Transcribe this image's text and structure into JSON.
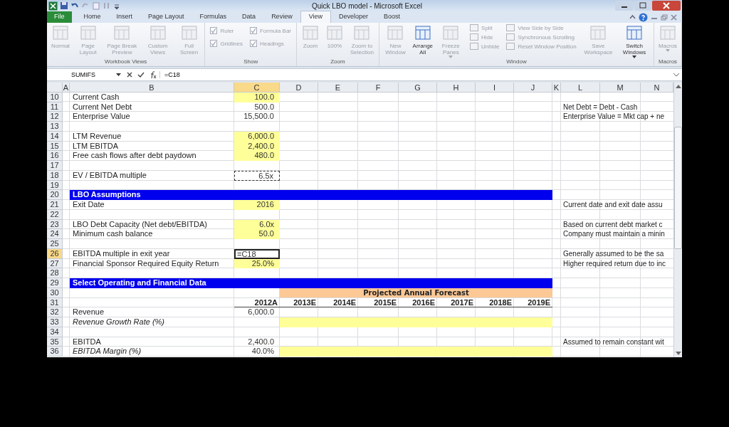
{
  "window": {
    "title": "Quick LBO model - Microsoft Excel"
  },
  "tabs": [
    {
      "label": "File",
      "kind": "file",
      "selected": false
    },
    {
      "label": "Home",
      "kind": "tab",
      "selected": false
    },
    {
      "label": "Insert",
      "kind": "tab",
      "selected": false
    },
    {
      "label": "Page Layout",
      "kind": "tab",
      "selected": false
    },
    {
      "label": "Formulas",
      "kind": "tab",
      "selected": false
    },
    {
      "label": "Data",
      "kind": "tab",
      "selected": false
    },
    {
      "label": "Review",
      "kind": "tab",
      "selected": false
    },
    {
      "label": "View",
      "kind": "tab",
      "selected": true
    },
    {
      "label": "Developer",
      "kind": "tab",
      "selected": false
    },
    {
      "label": "Boost",
      "kind": "tab",
      "selected": false
    }
  ],
  "ribbon": [
    {
      "label": "Workbook Views",
      "items": [
        {
          "kind": "large",
          "label": "Normal",
          "disabled": true
        },
        {
          "kind": "large",
          "label": "Page Layout",
          "disabled": true
        },
        {
          "kind": "large",
          "label": "Page Break Preview",
          "disabled": true
        },
        {
          "kind": "large",
          "label": "Custom Views",
          "disabled": true
        },
        {
          "kind": "large",
          "label": "Full Screen",
          "disabled": true
        }
      ]
    },
    {
      "label": "Show",
      "items": [
        {
          "kind": "column",
          "items": [
            {
              "kind": "check",
              "label": "Ruler",
              "checked": true,
              "disabled": true
            },
            {
              "kind": "check",
              "label": "Gridlines",
              "checked": true,
              "disabled": true
            }
          ]
        },
        {
          "kind": "column",
          "items": [
            {
              "kind": "check",
              "label": "Formula Bar",
              "checked": true,
              "disabled": true
            },
            {
              "kind": "check",
              "label": "Headings",
              "checked": true,
              "disabled": true
            }
          ]
        }
      ]
    },
    {
      "label": "Zoom",
      "items": [
        {
          "kind": "large",
          "label": "Zoom",
          "disabled": true
        },
        {
          "kind": "large",
          "label": "100%",
          "disabled": true
        },
        {
          "kind": "large",
          "label": "Zoom to Selection",
          "disabled": true
        }
      ]
    },
    {
      "label": "Window",
      "items": [
        {
          "kind": "large",
          "label": "New Window",
          "disabled": true
        },
        {
          "kind": "large",
          "label": "Arrange All",
          "disabled": false
        },
        {
          "kind": "large",
          "label": "Freeze Panes",
          "disabled": true,
          "dropdown": true
        },
        {
          "kind": "column",
          "items": [
            {
              "kind": "small",
              "label": "Split",
              "disabled": true
            },
            {
              "kind": "small",
              "label": "Hide",
              "disabled": true
            },
            {
              "kind": "small",
              "label": "Unhide",
              "disabled": true
            }
          ]
        },
        {
          "kind": "column",
          "items": [
            {
              "kind": "small",
              "label": "View Side by Side",
              "disabled": true
            },
            {
              "kind": "small",
              "label": "Synchronous Scrolling",
              "disabled": true
            },
            {
              "kind": "small",
              "label": "Reset Window Position",
              "disabled": true
            }
          ]
        },
        {
          "kind": "large",
          "label": "Save Workspace",
          "disabled": true
        },
        {
          "kind": "large",
          "label": "Switch Windows",
          "disabled": false,
          "dropdown": true
        }
      ]
    },
    {
      "label": "Macros",
      "items": [
        {
          "kind": "large",
          "label": "Macros",
          "disabled": true,
          "dropdown": true
        }
      ]
    }
  ],
  "formula_bar": {
    "name_box": "SUMIFS",
    "formula": "=C18"
  },
  "columns": [
    {
      "label": "A",
      "selected": false
    },
    {
      "label": "B",
      "selected": false
    },
    {
      "label": "C",
      "selected": true
    },
    {
      "label": "D",
      "selected": false
    },
    {
      "label": "E",
      "selected": false
    },
    {
      "label": "F",
      "selected": false
    },
    {
      "label": "G",
      "selected": false
    },
    {
      "label": "H",
      "selected": false
    },
    {
      "label": "I",
      "selected": false
    },
    {
      "label": "J",
      "selected": false
    },
    {
      "label": "K",
      "selected": false
    },
    {
      "label": "L",
      "selected": false
    },
    {
      "label": "M",
      "selected": false
    },
    {
      "label": "N",
      "selected": false
    }
  ],
  "rows": [
    {
      "number": "10",
      "selected": false,
      "kind": "data",
      "label": "Current Cash",
      "value": "100.0",
      "input": true
    },
    {
      "number": "11",
      "selected": false,
      "kind": "data",
      "label": "Current Net Debt",
      "value": "500.0",
      "note": "Net Debt = Debt - Cash"
    },
    {
      "number": "12",
      "selected": false,
      "kind": "data",
      "label": "Enterprise Value",
      "value": "15,500.0",
      "note": "Enterprise Value = Mkt cap + ne"
    },
    {
      "number": "13",
      "selected": false,
      "kind": "data"
    },
    {
      "number": "14",
      "selected": false,
      "kind": "data",
      "label": "LTM Revenue",
      "value": "6,000.0",
      "input": true
    },
    {
      "number": "15",
      "selected": false,
      "kind": "data",
      "label": "LTM EBITDA",
      "value": "2,400.0",
      "input": true
    },
    {
      "number": "16",
      "selected": false,
      "kind": "data",
      "label": "Free cash flows after debt paydown",
      "value": "480.0",
      "input": true
    },
    {
      "number": "17",
      "selected": false,
      "kind": "data"
    },
    {
      "number": "18",
      "selected": false,
      "kind": "data",
      "label": "EV / EBITDA multiple",
      "value": "6.5x",
      "copy_marquee": true
    },
    {
      "number": "19",
      "selected": false,
      "kind": "data"
    },
    {
      "number": "20",
      "selected": false,
      "kind": "section",
      "title": "LBO Assumptions"
    },
    {
      "number": "21",
      "selected": false,
      "kind": "data",
      "label": "Exit Date",
      "value": "2016",
      "input": true,
      "note": "Current date and exit date assu"
    },
    {
      "number": "22",
      "selected": false,
      "kind": "data"
    },
    {
      "number": "23",
      "selected": false,
      "kind": "data",
      "label": "LBO Debt Capacity (Net debt/EBITDA)",
      "value": "6.0x",
      "input": true,
      "note": "Based on current debt market c"
    },
    {
      "number": "24",
      "selected": false,
      "kind": "data",
      "label": "Minimum cash balance",
      "value": "50.0",
      "input": true,
      "note": "Company must maintain a minin"
    },
    {
      "number": "25",
      "selected": false,
      "kind": "data"
    },
    {
      "number": "26",
      "selected": true,
      "kind": "data",
      "label": "EBITDA multiple in exit year",
      "value": "=C18",
      "editing": true,
      "note": "Generally assumed to be the sa"
    },
    {
      "number": "27",
      "selected": false,
      "kind": "data",
      "label": "Financial Sponsor Required Equity Return",
      "value": "25.0%",
      "input": true,
      "note": "Higher required return due to inc"
    },
    {
      "number": "28",
      "selected": false,
      "kind": "data"
    },
    {
      "number": "29",
      "selected": false,
      "kind": "section",
      "title": "Select Operating and Financial Data"
    },
    {
      "number": "30",
      "selected": false,
      "kind": "band",
      "title": "Projected Annual Forecast"
    },
    {
      "number": "31",
      "selected": false,
      "kind": "years",
      "years": [
        "2012A",
        "2013E",
        "2014E",
        "2015E",
        "2016E",
        "2017E",
        "2018E",
        "2019E"
      ]
    },
    {
      "number": "32",
      "selected": false,
      "kind": "data",
      "label": "Revenue",
      "value": "6,000.0"
    },
    {
      "number": "33",
      "selected": false,
      "kind": "data",
      "label": "Revenue Growth Rate (%)",
      "italic": true,
      "forecast_input": true
    },
    {
      "number": "34",
      "selected": false,
      "kind": "data"
    },
    {
      "number": "35",
      "selected": false,
      "kind": "data",
      "label": "EBITDA",
      "value": "2,400.0",
      "note": "Assumed to remain constant wit"
    },
    {
      "number": "36",
      "selected": false,
      "kind": "data",
      "label": "EBITDA Margin (%)",
      "italic": true,
      "value": "40.0%",
      "forecast_input": true
    }
  ]
}
